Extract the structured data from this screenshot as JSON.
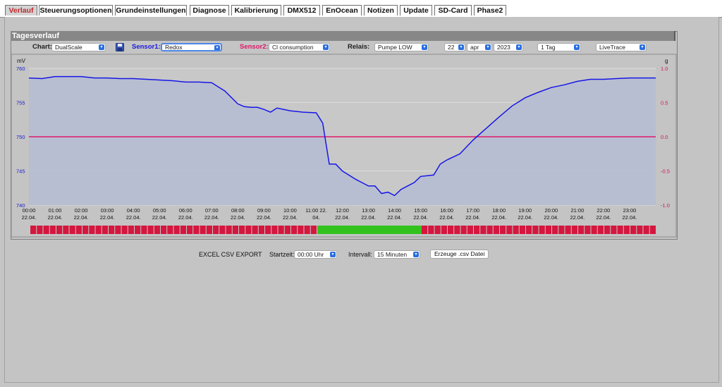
{
  "tabs": [
    {
      "label": "Verlauf",
      "active": true
    },
    {
      "label": "Steuerungsoptionen"
    },
    {
      "label": "Grundeinstellungen"
    },
    {
      "label": "Diagnose"
    },
    {
      "label": "Kalibrierung"
    },
    {
      "label": "DMX512"
    },
    {
      "label": "EnOcean"
    },
    {
      "label": "Notizen"
    },
    {
      "label": "Update"
    },
    {
      "label": "SD-Card"
    },
    {
      "label": "Phase2"
    }
  ],
  "panel": {
    "title": "Tagesverlauf"
  },
  "controls": {
    "chart_label": "Chart:",
    "chart_value": "DualScale",
    "sensor1_label": "Sensor1:",
    "sensor1_value": "Redox",
    "sensor2_label": "Sensor2:",
    "sensor2_value": "Cl consumption",
    "relais_label": "Relais:",
    "relais_value": "Pumpe LOW",
    "day": "22",
    "month": "apr",
    "year": "2023",
    "span": "1 Tag",
    "mode": "LiveTrace"
  },
  "colors": {
    "sensor1": "#1616e6",
    "sensor2": "#e0186a",
    "fill": "#b6bcd2",
    "relay_on": "#33c21d",
    "relay_off": "#d4173f"
  },
  "chart_data": {
    "type": "line",
    "left_unit": "mV",
    "right_unit": "g",
    "left_ylim": [
      740,
      760
    ],
    "left_ticks": [
      "760",
      "755",
      "750",
      "745",
      "740"
    ],
    "right_ylim": [
      -1.0,
      1.0
    ],
    "right_ticks": [
      "1.0",
      "0.5",
      "0.0",
      "-0.5",
      "-1.0"
    ],
    "x_ticks": [
      {
        "time": "00:00",
        "date": "22.04."
      },
      {
        "time": "01:00",
        "date": "22.04."
      },
      {
        "time": "02:00",
        "date": "22.04."
      },
      {
        "time": "03:00",
        "date": "22.04."
      },
      {
        "time": "04:00",
        "date": "22.04."
      },
      {
        "time": "05:00",
        "date": "22.04."
      },
      {
        "time": "06:00",
        "date": "22.04."
      },
      {
        "time": "07:00",
        "date": "22.04."
      },
      {
        "time": "08:00",
        "date": "22.04."
      },
      {
        "time": "09:00",
        "date": "22.04."
      },
      {
        "time": "10:00",
        "date": "22.04."
      },
      {
        "time": "11:00 22.",
        "date": "04."
      },
      {
        "time": "12:00",
        "date": "22.04."
      },
      {
        "time": "13:00",
        "date": "22.04."
      },
      {
        "time": "14:00",
        "date": "22.04."
      },
      {
        "time": "15:00",
        "date": "22.04."
      },
      {
        "time": "16:00",
        "date": "22.04."
      },
      {
        "time": "17:00",
        "date": "22.04."
      },
      {
        "time": "18:00",
        "date": "22.04."
      },
      {
        "time": "19:00",
        "date": "22.04."
      },
      {
        "time": "20:00",
        "date": "22.04."
      },
      {
        "time": "21:00",
        "date": "22.04."
      },
      {
        "time": "22:00",
        "date": "22.04."
      },
      {
        "time": "23:00",
        "date": "22.04."
      }
    ],
    "series": [
      {
        "axis": "left",
        "hours": [
          0,
          0.5,
          1,
          1.5,
          2,
          2.5,
          3,
          3.5,
          4,
          4.5,
          5,
          5.5,
          6,
          6.5,
          7,
          7.25,
          7.5,
          8,
          8.25,
          8.5,
          8.75,
          9,
          9.25,
          9.5,
          10,
          10.5,
          11,
          11.25,
          11.5,
          11.75,
          12,
          12.5,
          13,
          13.25,
          13.5,
          13.75,
          14,
          14.25,
          14.5,
          14.75,
          15,
          15.5,
          15.75,
          16,
          16.5,
          17,
          17.5,
          18,
          18.5,
          19,
          19.5,
          20,
          20.5,
          21,
          21.5,
          22,
          22.5,
          23,
          23.5,
          24
        ],
        "values": [
          758.6,
          758.5,
          758.8,
          758.8,
          758.8,
          758.6,
          758.6,
          758.5,
          758.5,
          758.4,
          758.3,
          758.2,
          758.0,
          758.0,
          757.9,
          757.3,
          756.7,
          754.8,
          754.4,
          754.3,
          754.3,
          754.0,
          753.6,
          754.2,
          753.8,
          753.6,
          753.5,
          752.0,
          746.0,
          746.0,
          745.0,
          743.8,
          742.8,
          742.8,
          741.7,
          741.9,
          741.4,
          742.3,
          742.8,
          743.3,
          744.2,
          744.4,
          746.0,
          746.6,
          747.5,
          749.5,
          751.2,
          752.9,
          754.5,
          755.7,
          756.5,
          757.2,
          757.6,
          758.1,
          758.4,
          758.4,
          758.5,
          758.6,
          758.6,
          758.6
        ]
      },
      {
        "axis": "right",
        "hours": [
          0,
          24
        ],
        "values": [
          0.0,
          0.0
        ]
      }
    ],
    "relay_segments": [
      {
        "from": 0,
        "to": 11,
        "state": "off"
      },
      {
        "from": 11,
        "to": 15,
        "state": "on"
      },
      {
        "from": 15,
        "to": 24,
        "state": "off"
      }
    ]
  },
  "export": {
    "label": "EXCEL CSV EXPORT",
    "start_label": "Startzeit:",
    "start_value": "00:00 Uhr",
    "interval_label": "Intervall:",
    "interval_value": "15 Minuten",
    "button": "Erzeuge .csv Datei"
  }
}
